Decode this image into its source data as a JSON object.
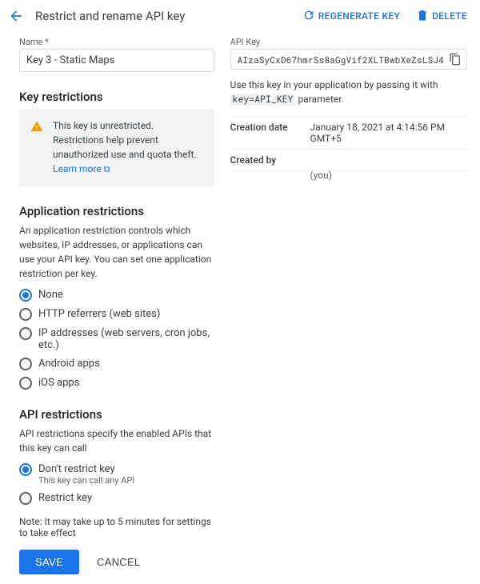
{
  "header": {
    "title": "Restrict and rename API key",
    "regen_label": "REGENERATE KEY",
    "delete_label": "DELETE"
  },
  "left": {
    "name_label": "Name *",
    "name_value": "Key 3 - Static Maps",
    "key_restrictions_heading": "Key restrictions",
    "warning_text": "This key is unrestricted. Restrictions help prevent unauthorized use and quota theft. ",
    "warning_link": "Learn more",
    "app_restrictions_heading": "Application restrictions",
    "app_restrictions_desc": "An application restriction controls which websites, IP addresses, or applications can use your API key. You can set one application restriction per key.",
    "app_options": [
      {
        "label": "None",
        "selected": true
      },
      {
        "label": "HTTP referrers (web sites)",
        "selected": false
      },
      {
        "label": "IP addresses (web servers, cron jobs, etc.)",
        "selected": false
      },
      {
        "label": "Android apps",
        "selected": false
      },
      {
        "label": "iOS apps",
        "selected": false
      }
    ],
    "api_restrictions_heading": "API restrictions",
    "api_restrictions_desc": "API restrictions specify the enabled APIs that this key can call",
    "api_options": [
      {
        "label": "Don't restrict key",
        "sub": "This key can call any API",
        "selected": true
      },
      {
        "label": "Restrict key",
        "selected": false
      }
    ],
    "note": "Note: It may take up to 5 minutes for settings to take effect",
    "save_label": "SAVE",
    "cancel_label": "CANCEL"
  },
  "right": {
    "api_key_label": "API Key",
    "api_key_value": "AIzaSyCxD67hmrSs8aGgVif2XLTBwbXeZsLSJ4",
    "hint_prefix": "Use this key in your application by passing it with ",
    "hint_code": "key=API_KEY",
    "hint_suffix": " parameter.",
    "creation_date_label": "Creation date",
    "creation_date_value": "January 18, 2021 at 4:14:56 PM GMT+5",
    "created_by_label": "Created by",
    "created_by_value": "",
    "created_by_sub": "(you)"
  }
}
